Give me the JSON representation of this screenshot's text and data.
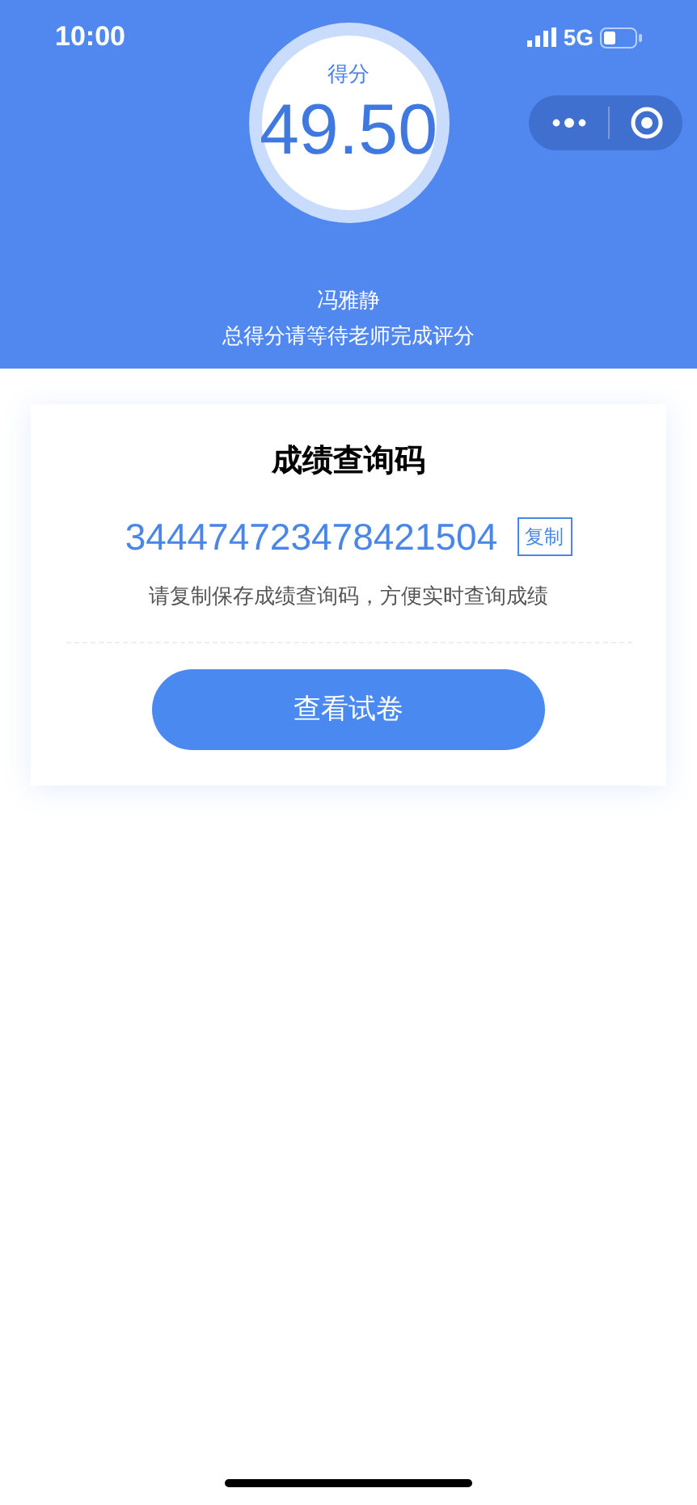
{
  "status_bar": {
    "time": "10:00",
    "network": "5G"
  },
  "score": {
    "label": "得分",
    "value": "49.50"
  },
  "student": {
    "name": "冯雅静",
    "note": "总得分请等待老师完成评分"
  },
  "card": {
    "title": "成绩查询码",
    "code": "344474723478421504",
    "copy_button": "复制",
    "hint": "请复制保存成绩查询码，方便实时查询成绩",
    "view_button": "查看试卷"
  }
}
